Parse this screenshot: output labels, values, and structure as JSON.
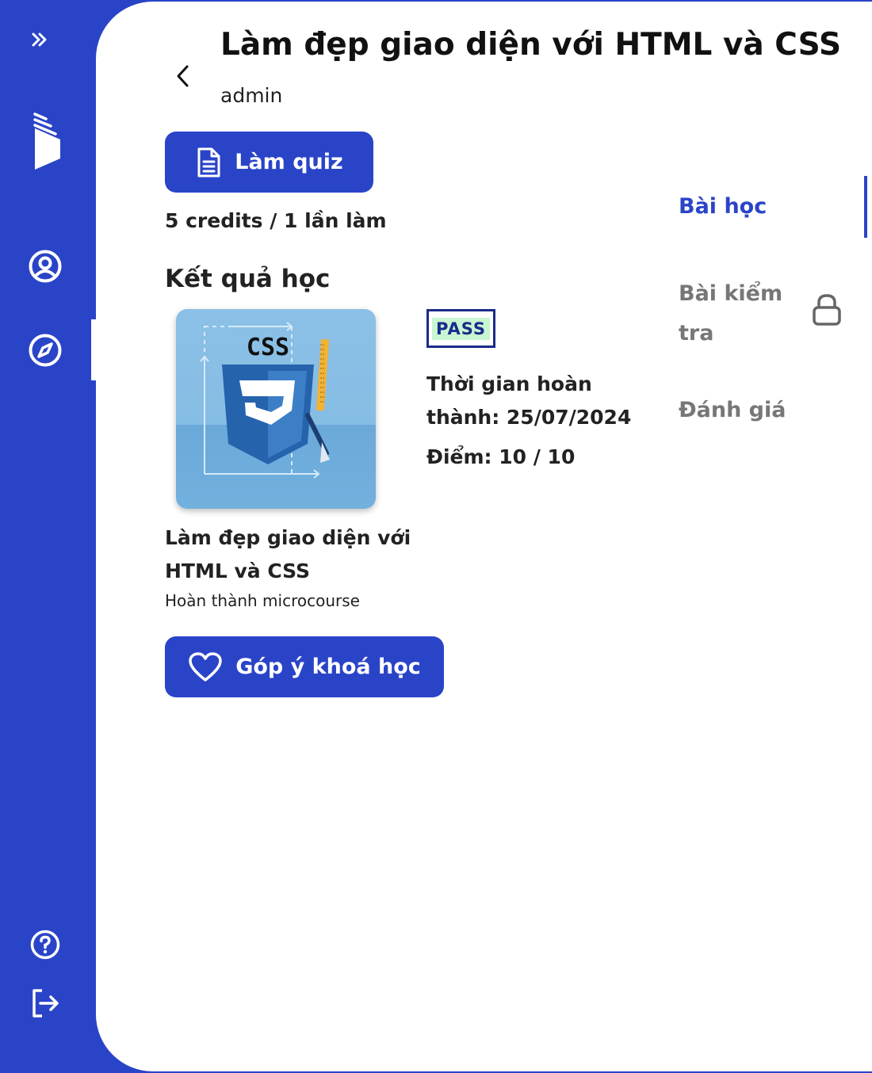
{
  "sidebar": {
    "items": [
      {
        "name": "expand-icon",
        "icon": "chevrons-right"
      },
      {
        "name": "logo-icon",
        "icon": "brand-logo"
      },
      {
        "name": "profile-icon",
        "icon": "user-circle"
      },
      {
        "name": "explore-icon",
        "icon": "compass"
      },
      {
        "name": "help-icon",
        "icon": "question-circle"
      },
      {
        "name": "logout-icon",
        "icon": "log-out"
      }
    ],
    "active": "explore-icon"
  },
  "header": {
    "title": "Làm đẹp giao diện với HTML và CSS",
    "subtitle": "admin"
  },
  "quiz": {
    "button_label": "Làm quiz",
    "credits_text": "5 credits / 1 lần làm"
  },
  "results": {
    "section_title": "Kết quả học",
    "course_name": "Làm đẹp giao diện với HTML và CSS",
    "course_desc": "Hoàn thành microcourse",
    "thumbnail_text": "CSS",
    "status": "PASS",
    "completion": "Thời gian hoàn thành: 25/07/2024",
    "score": "Điểm: 10 / 10"
  },
  "feedback": {
    "button_label": "Góp ý khoá học"
  },
  "tabs": [
    {
      "label": "Bài học",
      "active": true
    },
    {
      "label": "Bài kiểm tra",
      "locked": true
    },
    {
      "label": "Đánh giá"
    }
  ],
  "colors": {
    "primary": "#2a44c8",
    "pass_bg": "#c8f5d2",
    "pass_border": "#1a2a8a",
    "tab_inactive": "#777777"
  }
}
